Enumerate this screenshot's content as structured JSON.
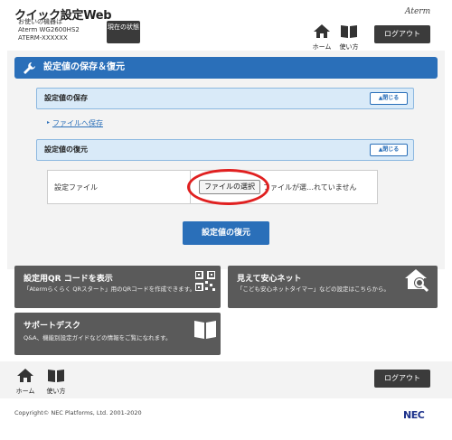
{
  "header": {
    "app_title": "クイック設定Web",
    "device_line1": "お使いの機器は",
    "device_line2": "Aterm WG2600HS2",
    "device_line3": "ATERM-XXXXXX",
    "status_button": "現在の状態",
    "brand": "Aterm",
    "home_label": "ホーム",
    "howto_label": "使い方",
    "logout_label": "ログアウト"
  },
  "page": {
    "title": "設定値の保存＆復元",
    "save_section": {
      "title": "設定値の保存",
      "close_label": "▲閉じる",
      "link": "ファイルへ保存"
    },
    "restore_section": {
      "title": "設定値の復元",
      "close_label": "▲閉じる"
    },
    "file_row": {
      "label": "設定ファイル",
      "choose_button": "ファイルの選択",
      "file_status": "ファイルが選…れていません"
    },
    "restore_button": "設定値の復元"
  },
  "tiles": [
    {
      "title": "設定用QR コードを表示",
      "desc": "「Atermらくらく QRスタート」用のQRコードを作成できます。",
      "icon": "qr-code-icon"
    },
    {
      "title": "見えて安心ネット",
      "desc": "「こども安心ネットタイマー」などの設定はこちらから。",
      "icon": "home-search-icon"
    },
    {
      "title": "サポートデスク",
      "desc": "Q&A、機能別設定ガイドなどの情報をご覧になれます。",
      "icon": "book-icon"
    }
  ],
  "footer": {
    "home_label": "ホーム",
    "howto_label": "使い方",
    "logout_label": "ログアウト",
    "copyright": "Copyright© NEC Platforms, Ltd. 2001-2020",
    "brand": "NEC"
  },
  "colors": {
    "accent": "#2a6fb9",
    "tile": "#5a5a5a",
    "highlight": "#e02020"
  }
}
